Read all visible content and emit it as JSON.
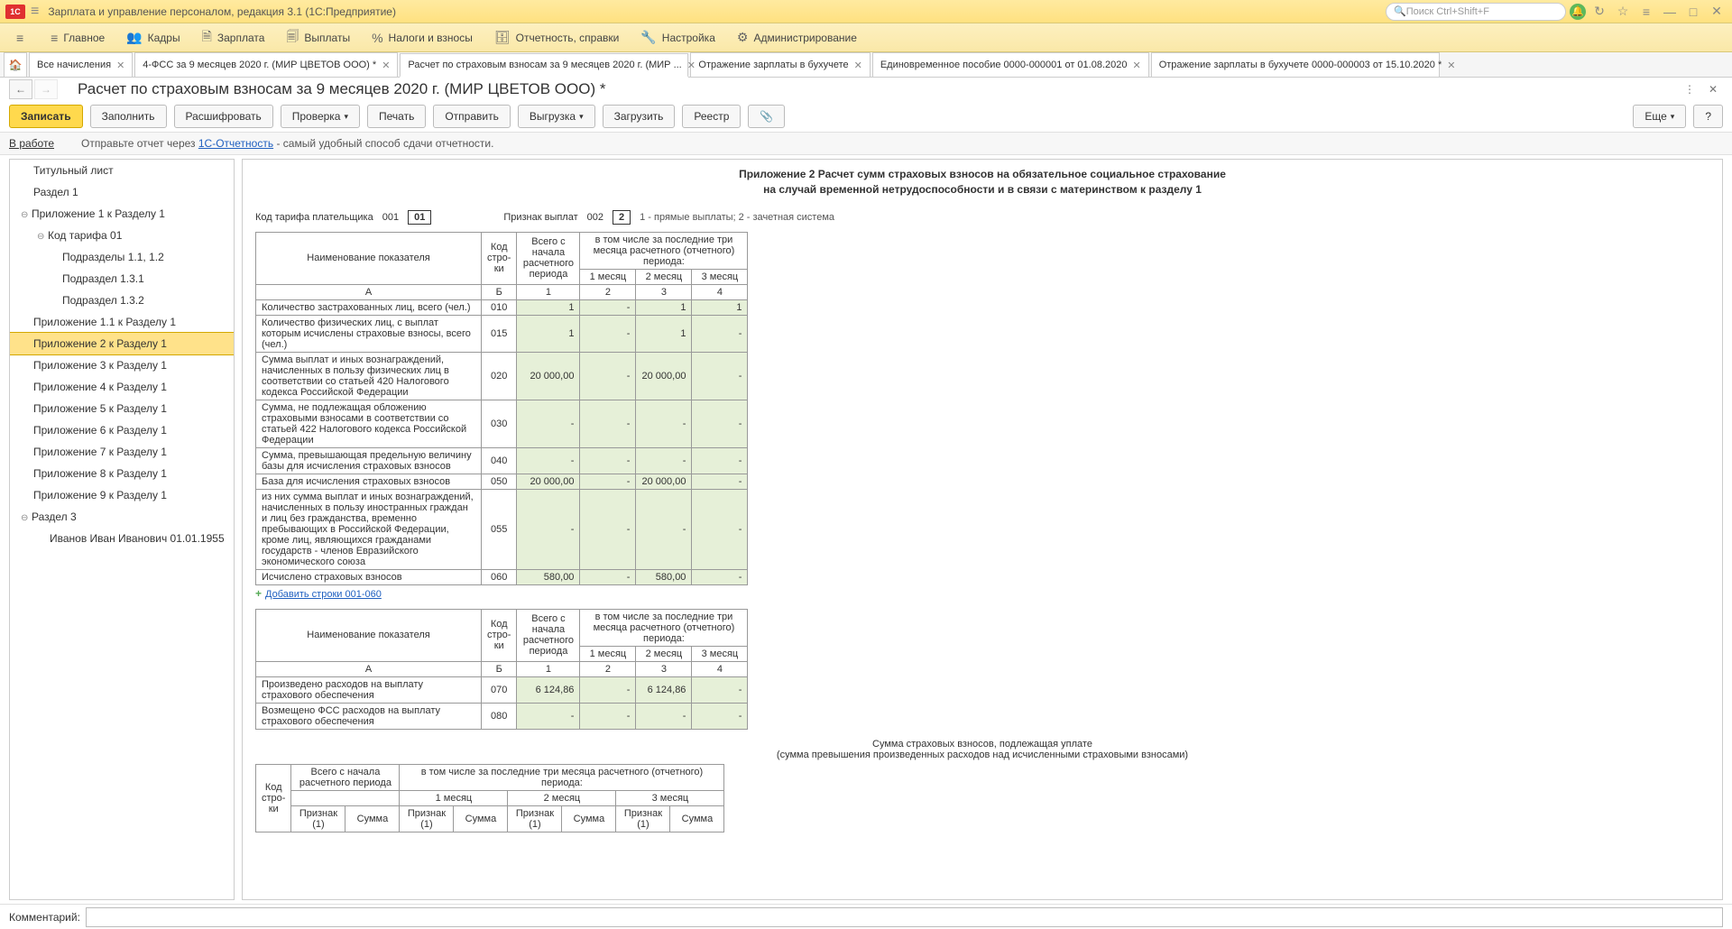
{
  "app": {
    "title": "Зарплата и управление персоналом, редакция 3.1  (1С:Предприятие)",
    "search_placeholder": "Поиск Ctrl+Shift+F"
  },
  "mainmenu": [
    {
      "icon": "≡",
      "label": "Главное"
    },
    {
      "icon": "👥",
      "label": "Кадры"
    },
    {
      "icon": "🗎",
      "label": "Зарплата"
    },
    {
      "icon": "🗐",
      "label": "Выплаты"
    },
    {
      "icon": "%",
      "label": "Налоги и взносы"
    },
    {
      "icon": "🗄",
      "label": "Отчетность, справки"
    },
    {
      "icon": "🔧",
      "label": "Настройка"
    },
    {
      "icon": "⚙",
      "label": "Администрирование"
    }
  ],
  "tabs": [
    {
      "label": "Все начисления",
      "close": true
    },
    {
      "label": "4-ФСС за 9 месяцев 2020 г. (МИР ЦВЕТОВ ООО) *",
      "close": true
    },
    {
      "label": "Расчет по страховым взносам за 9 месяцев 2020 г. (МИР ...",
      "close": true,
      "active": true
    },
    {
      "label": "Отражение зарплаты в бухучете",
      "close": true
    },
    {
      "label": "Единовременное пособие 0000-000001 от 01.08.2020",
      "close": true
    },
    {
      "label": "Отражение зарплаты в бухучете 0000-000003 от 15.10.2020 *",
      "close": true
    }
  ],
  "page": {
    "title": "Расчет по страховым взносам за 9 месяцев 2020 г. (МИР ЦВЕТОВ ООО) *"
  },
  "toolbar": {
    "save": "Записать",
    "fill": "Заполнить",
    "decode": "Расшифровать",
    "check": "Проверка",
    "print": "Печать",
    "send": "Отправить",
    "upload": "Выгрузка",
    "load": "Загрузить",
    "registry": "Реестр",
    "attach": "📎",
    "more": "Еще",
    "help": "?"
  },
  "statusbar": {
    "status": "В работе",
    "prefix": "Отправьте отчет через ",
    "link": "1С-Отчетность",
    "suffix": " - самый удобный способ сдачи отчетности."
  },
  "tree": [
    {
      "l": 1,
      "label": "Титульный лист"
    },
    {
      "l": 1,
      "label": "Раздел 1"
    },
    {
      "l": 1,
      "label": "Приложение 1 к Разделу 1",
      "twisty": "⊖"
    },
    {
      "l": 2,
      "label": "Код тарифа 01",
      "twisty": "⊖"
    },
    {
      "l": 3,
      "label": "Подразделы 1.1, 1.2"
    },
    {
      "l": 3,
      "label": "Подраздел 1.3.1"
    },
    {
      "l": 3,
      "label": "Подраздел 1.3.2"
    },
    {
      "l": 1,
      "label": "Приложение 1.1 к Разделу 1"
    },
    {
      "l": 1,
      "label": "Приложение 2 к Разделу 1",
      "selected": true
    },
    {
      "l": 1,
      "label": "Приложение 3 к Разделу 1"
    },
    {
      "l": 1,
      "label": "Приложение 4 к Разделу 1"
    },
    {
      "l": 1,
      "label": "Приложение 5 к Разделу 1"
    },
    {
      "l": 1,
      "label": "Приложение 6 к Разделу 1"
    },
    {
      "l": 1,
      "label": "Приложение 7 к Разделу 1"
    },
    {
      "l": 1,
      "label": "Приложение 8 к Разделу 1"
    },
    {
      "l": 1,
      "label": "Приложение 9 к Разделу 1"
    },
    {
      "l": 1,
      "label": "Раздел 3",
      "twisty": "⊖"
    },
    {
      "l": 2,
      "label": "Иванов Иван Иванович 01.01.1955"
    }
  ],
  "form": {
    "heading1": "Приложение 2 Расчет сумм страховых взносов на обязательное социальное страхование",
    "heading2": "на случай временной нетрудоспособности и в связи с материнством к разделу 1",
    "tarif_label": "Код тарифа плательщика",
    "tarif_code": "001",
    "tarif_val": "01",
    "sign_label": "Признак выплат",
    "sign_code": "002",
    "sign_val": "2",
    "sign_legend": "1 - прямые выплаты; 2 - зачетная система",
    "hdr": {
      "name": "Наименование показателя",
      "code": "Код стро-ки",
      "total": "Всего с начала расчетного периода",
      "last3": "в том числе за последние три месяца расчетного (отчетного) периода:",
      "m1": "1 месяц",
      "m2": "2 месяц",
      "m3": "3 месяц"
    },
    "colnums": {
      "a": "А",
      "b": "Б",
      "c1": "1",
      "c2": "2",
      "c3": "3",
      "c4": "4"
    },
    "rows1": [
      {
        "label": "Количество застрахованных лиц, всего (чел.)",
        "code": "010",
        "total": "1",
        "m1": "-",
        "m2": "1",
        "m3": "1"
      },
      {
        "label": "Количество физических лиц, с выплат которым исчислены страховые взносы, всего (чел.)",
        "code": "015",
        "total": "1",
        "m1": "-",
        "m2": "1",
        "m3": "-"
      },
      {
        "label": "Сумма выплат и иных вознаграждений, начисленных в пользу физических лиц в соответствии со статьей 420 Налогового кодекса Российской Федерации",
        "code": "020",
        "total": "20 000,00",
        "m1": "-",
        "m2": "20 000,00",
        "m3": "-"
      },
      {
        "label": "Сумма, не подлежащая обложению страховыми взносами в соответствии со статьей 422 Налогового кодекса Российской Федерации",
        "code": "030",
        "total": "-",
        "m1": "-",
        "m2": "-",
        "m3": "-"
      },
      {
        "label": "Сумма, превышающая предельную величину базы для исчисления страховых взносов",
        "code": "040",
        "total": "-",
        "m1": "-",
        "m2": "-",
        "m3": "-"
      },
      {
        "label": "База для исчисления страховых взносов",
        "code": "050",
        "total": "20 000,00",
        "m1": "-",
        "m2": "20 000,00",
        "m3": "-"
      },
      {
        "label": "из них сумма выплат и иных вознаграждений, начисленных в пользу иностранных граждан и лиц без гражданства, временно пребывающих в Российской Федерации, кроме лиц, являющихся гражданами государств - членов Евразийского экономического союза",
        "code": "055",
        "total": "-",
        "m1": "-",
        "m2": "-",
        "m3": "-"
      },
      {
        "label": "Исчислено страховых взносов",
        "code": "060",
        "total": "580,00",
        "m1": "-",
        "m2": "580,00",
        "m3": "-"
      }
    ],
    "addlink": "Добавить строки 001-060",
    "rows2": [
      {
        "label": "Произведено расходов на выплату страхового обеспечения",
        "code": "070",
        "total": "6 124,86",
        "m1": "-",
        "m2": "6 124,86",
        "m3": "-"
      },
      {
        "label": "Возмещено ФСС расходов на выплату страхового обеспечения",
        "code": "080",
        "total": "-",
        "m1": "-",
        "m2": "-",
        "m3": "-"
      }
    ],
    "section3": {
      "title1": "Сумма страховых взносов, подлежащая уплате",
      "title2": "(сумма превышения произведенных расходов над исчисленными страховыми взносами)",
      "hdr_total": "Всего с начала расчетного периода",
      "hdr_last3": "в том числе за последние три месяца расчетного (отчетного) периода:",
      "sign": "Признак (1)",
      "sum": "Сумма"
    }
  },
  "comment_label": "Комментарий:"
}
